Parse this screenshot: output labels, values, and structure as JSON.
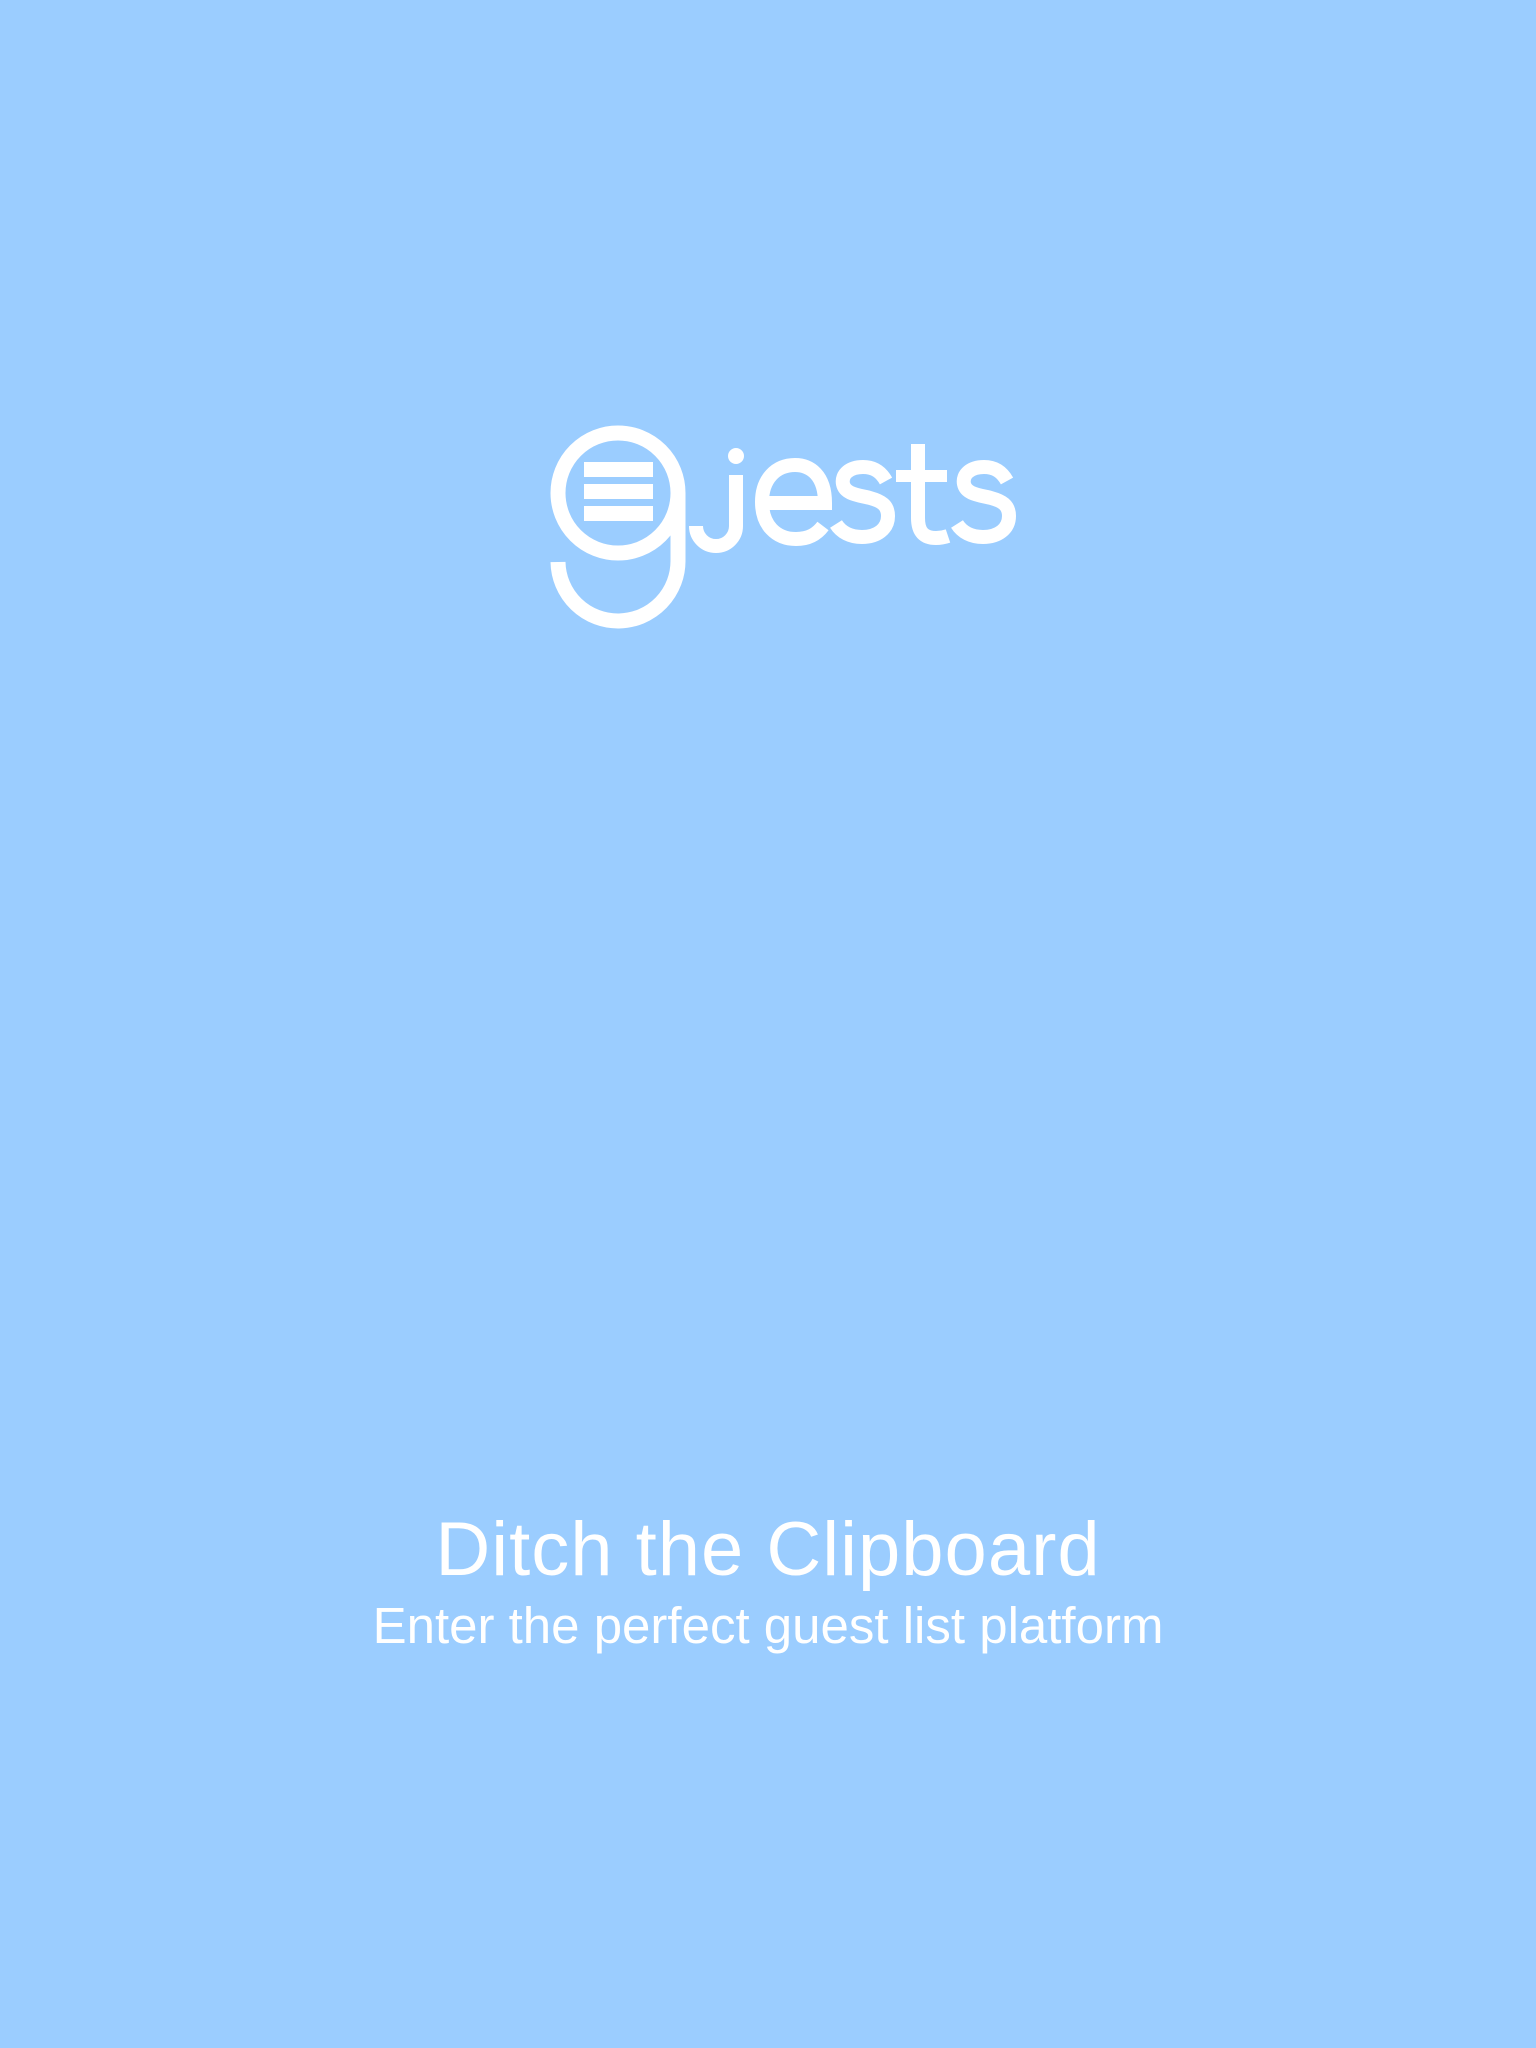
{
  "colors": {
    "background": "#9bcdff",
    "foreground": "#ffffff"
  },
  "logo": {
    "text": "gjests",
    "icon": "clipboard-g-icon"
  },
  "headline": "Ditch the Clipboard",
  "tagline": "Enter the perfect guest list platform"
}
